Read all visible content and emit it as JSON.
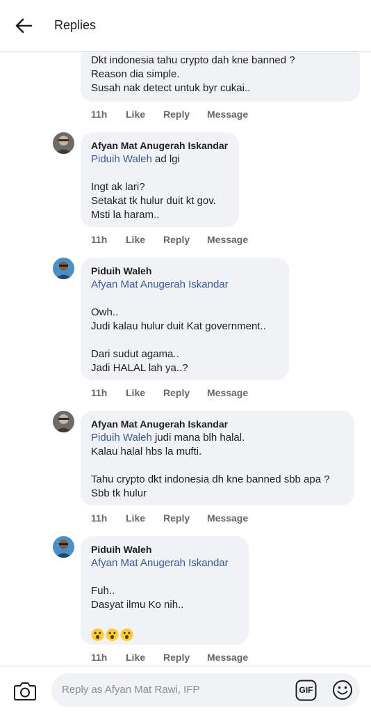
{
  "header": {
    "title": "Replies",
    "back_icon": "arrow-left-icon"
  },
  "replies": [
    {
      "author": "",
      "lines": [
        "Dkt indonesia tahu crypto dah kne banned ?",
        "Reason dia simple.",
        "Susah nak detect untuk byr cukai.."
      ],
      "actions": {
        "time": "11h",
        "like": "Like",
        "reply": "Reply",
        "message": "Message"
      }
    },
    {
      "author": "Afyan Mat Anugerah Iskandar",
      "mention": "Piduih Waleh",
      "mention_rest": " ad lgi",
      "lines": [
        "",
        "Ingt ak lari?",
        "Setakat tk hulur duit kt gov.",
        "Msti la haram.."
      ],
      "actions": {
        "time": "11h",
        "like": "Like",
        "reply": "Reply",
        "message": "Message"
      }
    },
    {
      "author": "Piduih Waleh",
      "mention": "Afyan Mat Anugerah Iskandar",
      "mention_rest": "",
      "lines": [
        "",
        "Owh..",
        "Judi kalau hulur duit Kat government..",
        "",
        "Dari sudut agama..",
        "Jadi HALAL lah ya..?"
      ],
      "actions": {
        "time": "11h",
        "like": "Like",
        "reply": "Reply",
        "message": "Message"
      }
    },
    {
      "author": "Afyan Mat Anugerah Iskandar",
      "mention": "Piduih Waleh",
      "mention_rest": " judi mana blh halal.",
      "lines": [
        "Kalau halal hbs la mufti.",
        "",
        "Tahu crypto dkt indonesia dh kne banned sbb apa ?",
        "Sbb tk hulur"
      ],
      "actions": {
        "time": "11h",
        "like": "Like",
        "reply": "Reply",
        "message": "Message"
      }
    },
    {
      "author": "Piduih Waleh",
      "mention": "Afyan Mat Anugerah Iskandar",
      "mention_rest": "",
      "lines": [
        "",
        "Fuh..",
        "Dasyat ilmu Ko nih..",
        ""
      ],
      "emojis": [
        "astonished-face-icon",
        "astonished-face-icon",
        "astonished-face-icon"
      ],
      "actions": {
        "time": "11h",
        "like": "Like",
        "reply": "Reply",
        "message": "Message"
      }
    }
  ],
  "composer": {
    "placeholder": "Reply as Afyan Mat Rawi, IFP",
    "camera_icon": "camera-icon",
    "gif_label": "GIF",
    "emoji_icon": "smiley-icon"
  },
  "colors": {
    "bubble": "#f0f2f5",
    "mention": "#385898",
    "meta": "#65676b"
  }
}
